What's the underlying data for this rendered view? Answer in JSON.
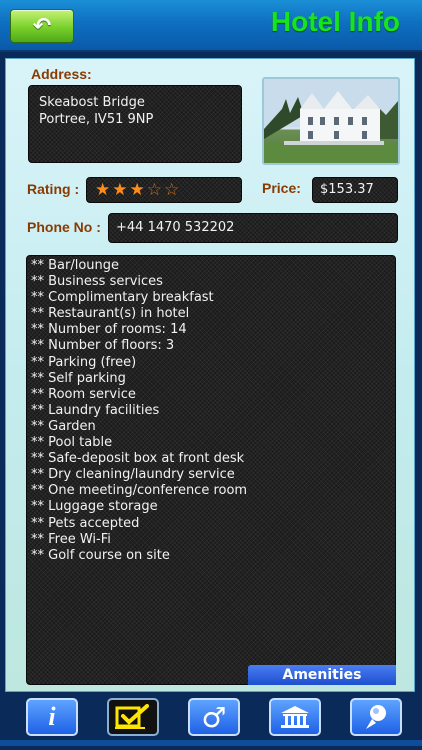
{
  "header": {
    "back_label": "↶",
    "title": "Hotel Info"
  },
  "address": {
    "label": "Address:",
    "line1": "Skeabost Bridge",
    "line2": "Portree, IV51 9NP"
  },
  "rating": {
    "label": "Rating :",
    "stars_filled": 3,
    "stars_total": 5,
    "star_filled_glyph": "★",
    "star_empty_glyph": "☆"
  },
  "price": {
    "label": "Price:",
    "value": "$153.37"
  },
  "phone": {
    "label": "Phone No :",
    "value": "+44 1470 532202"
  },
  "amenities": {
    "tab_label": "Amenities",
    "items": [
      "** Bar/lounge",
      "** Business services",
      "** Complimentary breakfast",
      "** Restaurant(s) in hotel",
      "** Number of rooms: 14",
      "** Number of floors: 3",
      "** Parking (free)",
      "** Self parking",
      "** Room service",
      "** Laundry facilities",
      "** Garden",
      "** Pool table",
      "** Safe-deposit box at front desk",
      "** Dry cleaning/laundry service",
      "** One meeting/conference room",
      "** Luggage storage",
      "** Pets accepted",
      "** Free Wi-Fi",
      "** Golf course on site"
    ]
  },
  "toolbar": {
    "items": [
      {
        "icon": "info-icon",
        "glyph": "i",
        "selected": false
      },
      {
        "icon": "checkmark-icon",
        "glyph": "✔",
        "selected": true
      },
      {
        "icon": "male-symbol-icon",
        "glyph": "♂",
        "selected": false
      },
      {
        "icon": "bank-icon",
        "glyph": "🏛",
        "selected": false
      },
      {
        "icon": "map-pin-icon",
        "glyph": "📍",
        "selected": false
      }
    ]
  },
  "colors": {
    "header_blue": "#0e6fc1",
    "title_green": "#19e31f",
    "label_brown": "#8a3a00",
    "star_orange": "#ff8c1a",
    "tab_blue": "#1d4fcf"
  }
}
